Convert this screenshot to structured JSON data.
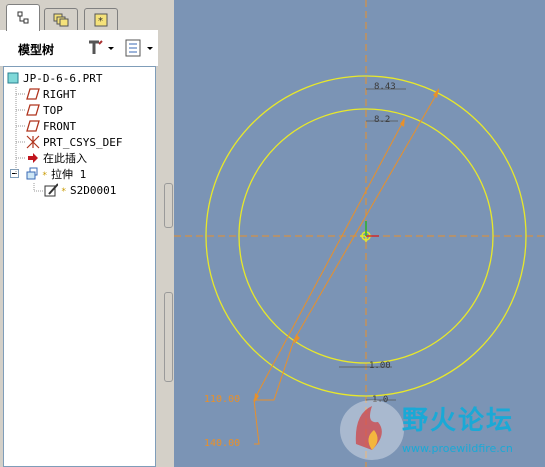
{
  "panel": {
    "title": "模型树",
    "tabs": [
      "model-tree",
      "layers",
      "favorites"
    ]
  },
  "tree": {
    "root": "JP-D-6-6.PRT",
    "items": [
      {
        "label": "RIGHT",
        "icon": "datum-plane-icon"
      },
      {
        "label": "TOP",
        "icon": "datum-plane-icon"
      },
      {
        "label": "FRONT",
        "icon": "datum-plane-icon"
      },
      {
        "label": "PRT_CSYS_DEF",
        "icon": "coordinate-system-icon"
      },
      {
        "label": "在此插入",
        "icon": "insert-here-arrow-icon"
      },
      {
        "label": "拉伸 1",
        "icon": "extrude-icon"
      },
      {
        "label": "S2D0001",
        "icon": "sketch-icon"
      }
    ]
  },
  "sketch": {
    "dim_diameter_outer": "110.00",
    "dim_diameter_inner": "140.00",
    "dim_top_1": "8.43",
    "dim_top_2": "8.2",
    "dim_bottom_1": "1.00",
    "dim_bottom_2": "1.0"
  },
  "colors": {
    "canvas_bg": "#7b94b5",
    "circle": "#e8e82a",
    "dimension": "#e8902a",
    "axis_dash": "#e8902a",
    "tree_border": "#7f9db9"
  },
  "watermark": {
    "title": "野火论坛",
    "url": "www.proewildfire.cn"
  }
}
